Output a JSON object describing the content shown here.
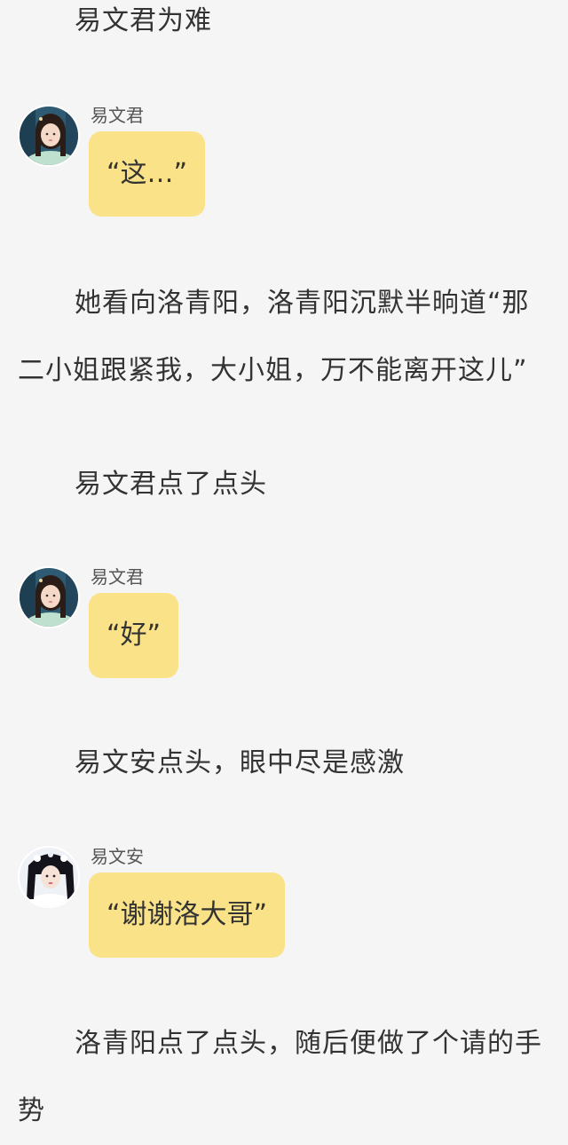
{
  "story": [
    {
      "type": "narration",
      "text": "易文君为难"
    },
    {
      "type": "dialogue",
      "speaker": "易文君",
      "avatar": "yi-wenjun-avatar",
      "text": "“这…”"
    },
    {
      "type": "narration",
      "text": "她看向洛青阳，洛青阳沉默半晌道“那二小姐跟紧我，大小姐，万不能离开这儿”"
    },
    {
      "type": "narration",
      "text": "易文君点了点头"
    },
    {
      "type": "dialogue",
      "speaker": "易文君",
      "avatar": "yi-wenjun-avatar",
      "text": "“好”"
    },
    {
      "type": "narration",
      "text": "易文安点头，眼中尽是感激"
    },
    {
      "type": "dialogue",
      "speaker": "易文安",
      "avatar": "yi-wenan-avatar",
      "text": "“谢谢洛大哥”"
    },
    {
      "type": "narration",
      "text": "洛青阳点了点头，随后便做了个请的手势"
    }
  ],
  "colors": {
    "background": "#f5f5f5",
    "bubble": "#fae289",
    "text": "#333333",
    "speaker": "#555555"
  }
}
